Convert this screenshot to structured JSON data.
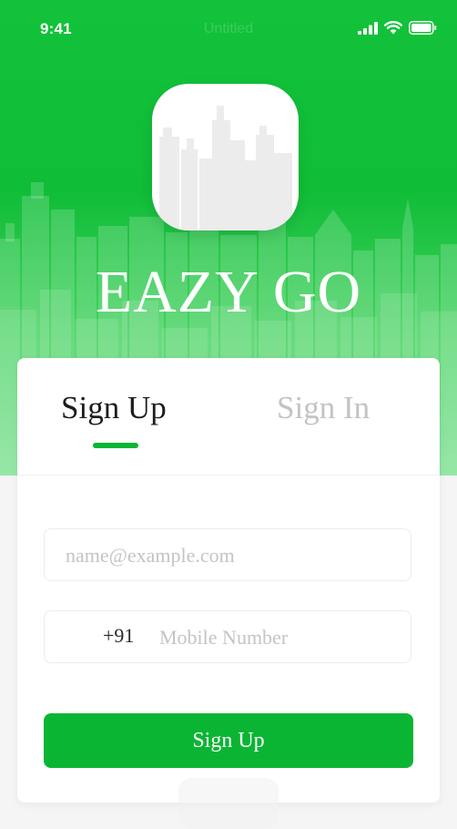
{
  "status_bar": {
    "time": "9:41",
    "title": "Untitled",
    "icons": [
      "signal-icon",
      "wifi-icon",
      "battery-icon"
    ]
  },
  "app": {
    "title": "EAZY GO"
  },
  "tabs": [
    {
      "label": "Sign Up",
      "active": true
    },
    {
      "label": "Sign In",
      "active": false
    }
  ],
  "form": {
    "email_placeholder": "name@example.com",
    "country_code": "+91",
    "phone_placeholder": "Mobile Number",
    "submit_label": "Sign Up"
  },
  "colors": {
    "brand_green": "#0bb534",
    "hero_green": "#13c23a",
    "inactive_tab": "#c3c3c3"
  }
}
